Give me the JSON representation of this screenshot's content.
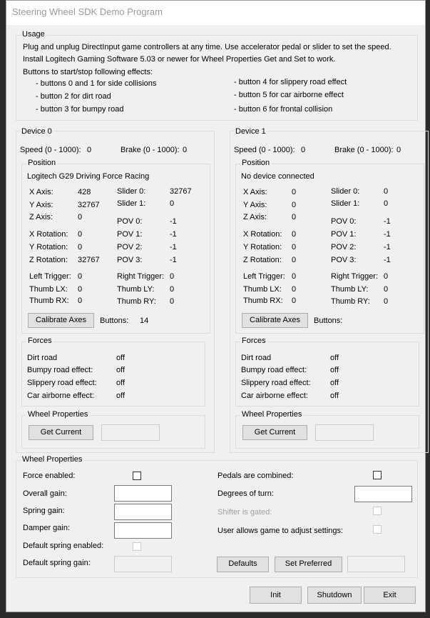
{
  "window": {
    "title": "Steering Wheel SDK Demo Program"
  },
  "usage": {
    "title": "Usage",
    "line1": "Plug and unplug DirectInput game controllers at any time. Use accelerator pedal or slider to set the speed.",
    "line2": "Install Logitech Gaming Software 5.03 or newer for Wheel Properties Get and Set to work.",
    "line3": "Buttons to start/stop following effects:",
    "left": [
      "- buttons 0 and 1 for side collisions",
      "- button 2 for dirt road",
      "- button 3 for bumpy road"
    ],
    "right": [
      "- button 4 for slippery road effect",
      "- button 5 for car airborne effect",
      "- button 6 for frontal collision"
    ]
  },
  "devices": [
    {
      "title": "Device 0",
      "speed_label": "Speed (0 - 1000):",
      "speed": "0",
      "brake_label": "Brake (0 - 1000):",
      "brake": "0",
      "position_title": "Position",
      "name": "Logitech G29 Driving Force Racing",
      "left": [
        {
          "label": "X Axis:",
          "value": "428"
        },
        {
          "label": "Y Axis:",
          "value": "32767"
        },
        {
          "label": "Z Axis:",
          "value": "0"
        },
        {
          "label": "X Rotation:",
          "value": "0"
        },
        {
          "label": "Y Rotation:",
          "value": "0"
        },
        {
          "label": "Z Rotation:",
          "value": "32767"
        },
        {
          "label": "Left Trigger:",
          "value": "0"
        },
        {
          "label": "Thumb LX:",
          "value": "0"
        },
        {
          "label": "Thumb RX:",
          "value": "0"
        }
      ],
      "right": [
        {
          "label": "Slider 0:",
          "value": "32767"
        },
        {
          "label": "Slider 1:",
          "value": "0"
        },
        {
          "label": "POV 0:",
          "value": "-1"
        },
        {
          "label": "POV 1:",
          "value": "-1"
        },
        {
          "label": "POV 2:",
          "value": "-1"
        },
        {
          "label": "POV 3:",
          "value": "-1"
        },
        {
          "label": "Right Trigger:",
          "value": "0"
        },
        {
          "label": "Thumb LY:",
          "value": "0"
        },
        {
          "label": "Thumb RY:",
          "value": "0"
        }
      ],
      "calibrate": "Calibrate Axes",
      "buttons_label": "Buttons:",
      "buttons": "14",
      "forces_title": "Forces",
      "forces": [
        {
          "label": "Dirt road",
          "value": "off"
        },
        {
          "label": "Bumpy road effect:",
          "value": "off"
        },
        {
          "label": "Slippery road effect:",
          "value": "off"
        },
        {
          "label": "Car airborne effect:",
          "value": "off"
        }
      ],
      "wheel_title": "Wheel Properties",
      "get_current": "Get Current"
    },
    {
      "title": "Device 1",
      "speed_label": "Speed (0 - 1000):",
      "speed": "0",
      "brake_label": "Brake (0 - 1000):",
      "brake": "0",
      "position_title": "Position",
      "name": "No device connected",
      "left": [
        {
          "label": "X Axis:",
          "value": "0"
        },
        {
          "label": "Y Axis:",
          "value": "0"
        },
        {
          "label": "Z Axis:",
          "value": "0"
        },
        {
          "label": "X Rotation:",
          "value": "0"
        },
        {
          "label": "Y Rotation:",
          "value": "0"
        },
        {
          "label": "Z Rotation:",
          "value": "0"
        },
        {
          "label": "Left Trigger:",
          "value": "0"
        },
        {
          "label": "Thumb LX:",
          "value": "0"
        },
        {
          "label": "Thumb RX:",
          "value": "0"
        }
      ],
      "right": [
        {
          "label": "Slider 0:",
          "value": "0"
        },
        {
          "label": "Slider 1:",
          "value": "0"
        },
        {
          "label": "POV 0:",
          "value": "-1"
        },
        {
          "label": "POV 1:",
          "value": "-1"
        },
        {
          "label": "POV 2:",
          "value": "-1"
        },
        {
          "label": "POV 3:",
          "value": "-1"
        },
        {
          "label": "Right Trigger:",
          "value": "0"
        },
        {
          "label": "Thumb LY:",
          "value": "0"
        },
        {
          "label": "Thumb RY:",
          "value": "0"
        }
      ],
      "calibrate": "Calibrate Axes",
      "buttons_label": "Buttons:",
      "buttons": "",
      "forces_title": "Forces",
      "forces": [
        {
          "label": "Dirt road",
          "value": "off"
        },
        {
          "label": "Bumpy road effect:",
          "value": "off"
        },
        {
          "label": "Slippery road effect:",
          "value": "off"
        },
        {
          "label": "Car airborne effect:",
          "value": "off"
        }
      ],
      "wheel_title": "Wheel Properties",
      "get_current": "Get Current"
    }
  ],
  "wheel": {
    "title": "Wheel Properties",
    "force_enabled": "Force enabled:",
    "overall_gain": "Overall gain:",
    "spring_gain": "Spring gain:",
    "damper_gain": "Damper gain:",
    "default_spring_enabled": "Default spring enabled:",
    "default_spring_gain": "Default spring gain:",
    "pedals_combined": "Pedals are combined:",
    "degrees": "Degrees of turn:",
    "shifter": "Shifter is gated:",
    "user_allows": "User allows game to adjust settings:",
    "defaults": "Defaults",
    "set_preferred": "Set Preferred"
  },
  "footer": {
    "init": "Init",
    "shutdown": "Shutdown",
    "exit": "Exit"
  }
}
